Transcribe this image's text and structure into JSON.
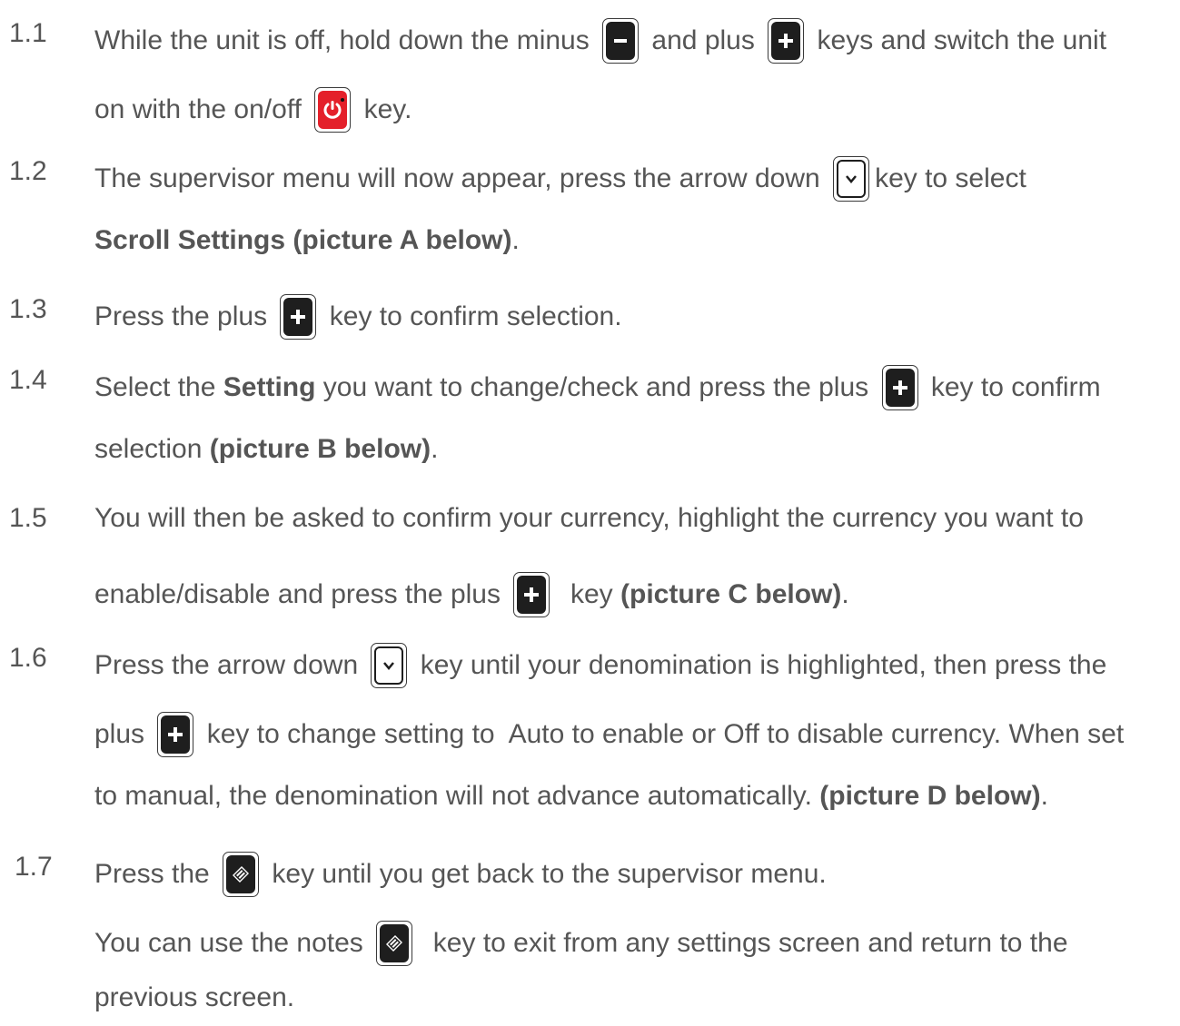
{
  "steps": [
    {
      "num": "1.1",
      "l1a": "While the unit is off, hold down the minus ",
      "l1b": " and plus ",
      "l1c": " keys and switch the unit",
      "l2a": "on with the on/off ",
      "l2b": " key."
    },
    {
      "num": "1.2",
      "l1a": "The supervisor menu will now appear, press the arrow down ",
      "l1b": "key to select",
      "l2bold": "Scroll Settings (picture A below)",
      "l2end": "."
    },
    {
      "num": "1.3",
      "l1a": "Press the plus ",
      "l1b": " key to confirm selection."
    },
    {
      "num": "1.4",
      "l1a": "Select the ",
      "l1bold": "Setting",
      "l1b": " you want to change/check and press the plus ",
      "l1c": " key to confirm",
      "l2a": "selection ",
      "l2bold": "(picture B below)",
      "l2end": "."
    },
    {
      "num": "1.5",
      "l1a": "You will then be asked to confirm your currency, highlight the currency you want to",
      "l2a": "enable/disable and press the plus ",
      "l2b": "  key ",
      "l2bold": "(picture C below)",
      "l2end": "."
    },
    {
      "num": "1.6",
      "l1a": "Press the arrow down ",
      "l1b": " key until your denomination is highlighted, then press the",
      "l2a": "plus ",
      "l2b": " key to change setting to  Auto to enable or Off to disable currency. When set",
      "l3a": "to manual, the denomination will not advance automatically. ",
      "l3bold": "(picture D below)",
      "l3end": "."
    },
    {
      "num": "1.7",
      "l1a": "Press the ",
      "l1b": " key until you get back to the supervisor menu.",
      "l2a": "You can use the notes ",
      "l2b": "  key to exit from any settings screen and return to the",
      "l3a": "previous screen."
    }
  ],
  "icons": {
    "minus": "minus-key-icon",
    "plus": "plus-key-icon",
    "power": "power-key-icon",
    "arrow_down": "arrow-down-key-icon",
    "notes": "notes-key-icon"
  },
  "colors": {
    "text": "#555555",
    "key": "#1e1e1e",
    "power": "#e4202a"
  }
}
